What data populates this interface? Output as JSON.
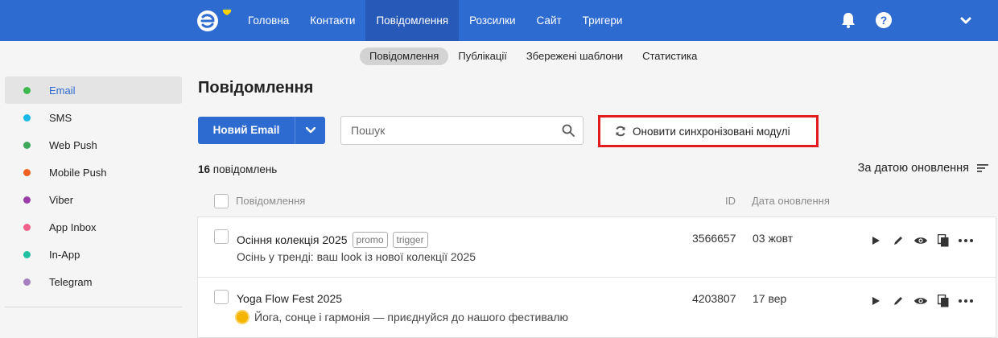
{
  "colors": {
    "brand": "#2e6bd1",
    "highlight": "#e21c1c"
  },
  "nav": {
    "items": [
      {
        "label": "Головна"
      },
      {
        "label": "Контакти"
      },
      {
        "label": "Повідомлення"
      },
      {
        "label": "Розсилки"
      },
      {
        "label": "Сайт"
      },
      {
        "label": "Тригери"
      }
    ],
    "active": "Повідомлення",
    "icons": [
      "logo",
      "bell-icon",
      "help-icon",
      "chevron-down-icon"
    ]
  },
  "subnav": {
    "items": [
      {
        "label": "Повідомлення"
      },
      {
        "label": "Публікації"
      },
      {
        "label": "Збережені шаблони"
      },
      {
        "label": "Статистика"
      }
    ],
    "active": "Повідомлення"
  },
  "sidebar": {
    "items": [
      {
        "label": "Email",
        "color": "#3dba4e"
      },
      {
        "label": "SMS",
        "color": "#16b9e8"
      },
      {
        "label": "Web Push",
        "color": "#3ea95a"
      },
      {
        "label": "Mobile Push",
        "color": "#f06020"
      },
      {
        "label": "Viber",
        "color": "#9b3da8"
      },
      {
        "label": "App Inbox",
        "color": "#f0608a"
      },
      {
        "label": "In-App",
        "color": "#20c0a0"
      },
      {
        "label": "Telegram",
        "color": "#a580c0"
      }
    ],
    "active": "Email"
  },
  "main": {
    "title": "Повідомлення",
    "new_button": "Новий Email",
    "search_placeholder": "Пошук",
    "sync_button": "Оновити синхронізовані модулі",
    "count_number": "16",
    "count_label": "повідомлень",
    "sort_label": "За датою оновлення",
    "columns": {
      "message": "Повідомлення",
      "id": "ID",
      "date": "Дата оновлення"
    },
    "rows": [
      {
        "title": "Осіння колекція 2025",
        "tags": [
          "promo",
          "trigger"
        ],
        "subtitle": "Осінь у тренді: ваш look із нової колекції 2025",
        "id": "3566657",
        "date": "03 жовт",
        "emoji": ""
      },
      {
        "title": "Yoga Flow Fest 2025",
        "tags": [],
        "subtitle": "Йога, сонце і гармонія — приєднуйся до нашого фестивалю",
        "id": "4203807",
        "date": "17 вер",
        "emoji": "sun"
      }
    ]
  }
}
